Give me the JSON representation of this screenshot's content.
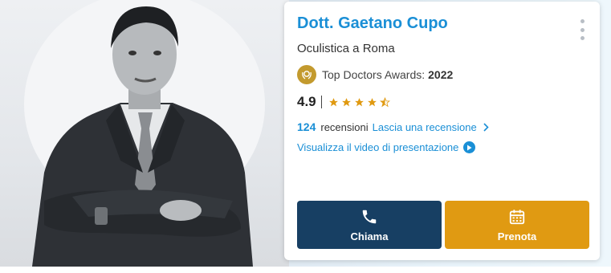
{
  "doctor": {
    "name": "Dott. Gaetano Cupo",
    "specialty": "Oculistica a Roma"
  },
  "award": {
    "label": "Top Doctors Awards:",
    "year": "2022",
    "icon": "laurel-badge-icon",
    "badge_color": "#c39a2e"
  },
  "rating": {
    "value": "4.9",
    "stars": 4.5,
    "max_stars": 5,
    "star_color": "#e09a12"
  },
  "reviews": {
    "count": "124",
    "label": "recensioni",
    "link_label": "Lascia una recensione"
  },
  "video": {
    "label": "Visualizza il video di presentazione"
  },
  "actions": {
    "call_label": "Chiama",
    "book_label": "Prenota",
    "call_color": "#173f63",
    "book_color": "#e09a12"
  },
  "colors": {
    "accent": "#1a8fd6"
  }
}
